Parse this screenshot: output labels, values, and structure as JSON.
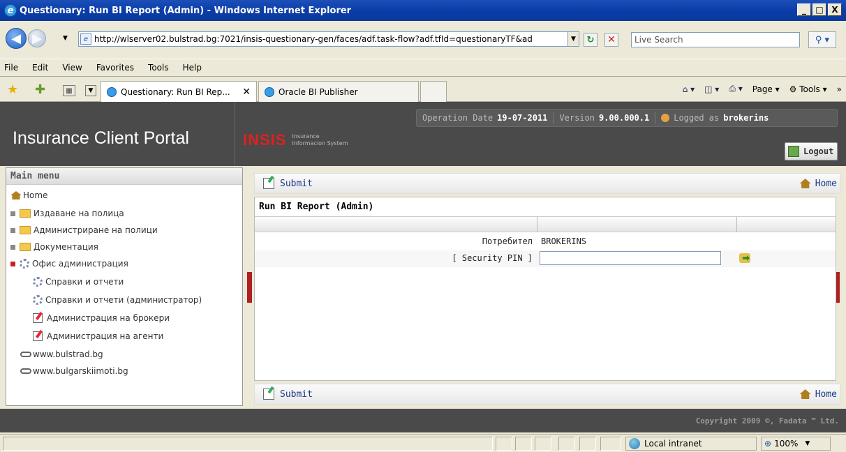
{
  "window": {
    "title": "Questionary: Run BI Report (Admin) - Windows Internet Explorer",
    "controls": [
      "_",
      "□",
      "X"
    ]
  },
  "address": {
    "url": "http://wlserver02.bulstrad.bg:7021/insis-questionary-gen/faces/adf.task-flow?adf.tfId=questionaryTF&ad",
    "search_placeholder": "Live Search"
  },
  "menubar": {
    "items": [
      "File",
      "Edit",
      "View",
      "Favorites",
      "Tools",
      "Help"
    ]
  },
  "tabs": [
    {
      "label": "Questionary: Run BI Rep...",
      "active": true
    },
    {
      "label": "Oracle BI Publisher",
      "active": false
    }
  ],
  "command_bar": {
    "page_label": "Page",
    "tools_label": "Tools"
  },
  "portal": {
    "title": "Insurance Client Portal",
    "logo_text": "INSIS",
    "logo_sub1": "Insurance",
    "logo_sub2": "Informacion System",
    "operation_date_label": "Operation Date",
    "operation_date": "19-07-2011",
    "version_label": "Version",
    "version": "9.00.000.1",
    "logged_as_label": "Logged as",
    "user": "brokerins",
    "logout_label": "Logout"
  },
  "sidebar": {
    "title": "Main menu",
    "items": [
      {
        "label": "Home"
      },
      {
        "label": "Издаване на полица"
      },
      {
        "label": "Администриране на полици"
      },
      {
        "label": "Документация"
      },
      {
        "label": "Офис администрация"
      },
      {
        "label": "Справки и отчети"
      },
      {
        "label": "Справки и отчети (администратор)"
      },
      {
        "label": "Администрация на брокери"
      },
      {
        "label": "Администрация на агенти"
      },
      {
        "label": "www.bulstrad.bg"
      },
      {
        "label": "www.bulgarskiimoti.bg"
      }
    ]
  },
  "main": {
    "submit_label": "Submit",
    "home_label": "Home",
    "panel_title": "Run BI Report (Admin)",
    "fields": [
      {
        "label": "Потребител",
        "value": "BROKERINS"
      },
      {
        "label": "[ Security PIN ]",
        "value": ""
      }
    ]
  },
  "footer": {
    "copyright": "Copyright 2009 ©, Fadata ™ Ltd."
  },
  "statusbar": {
    "zone": "Local intranet",
    "zoom": "100%"
  }
}
